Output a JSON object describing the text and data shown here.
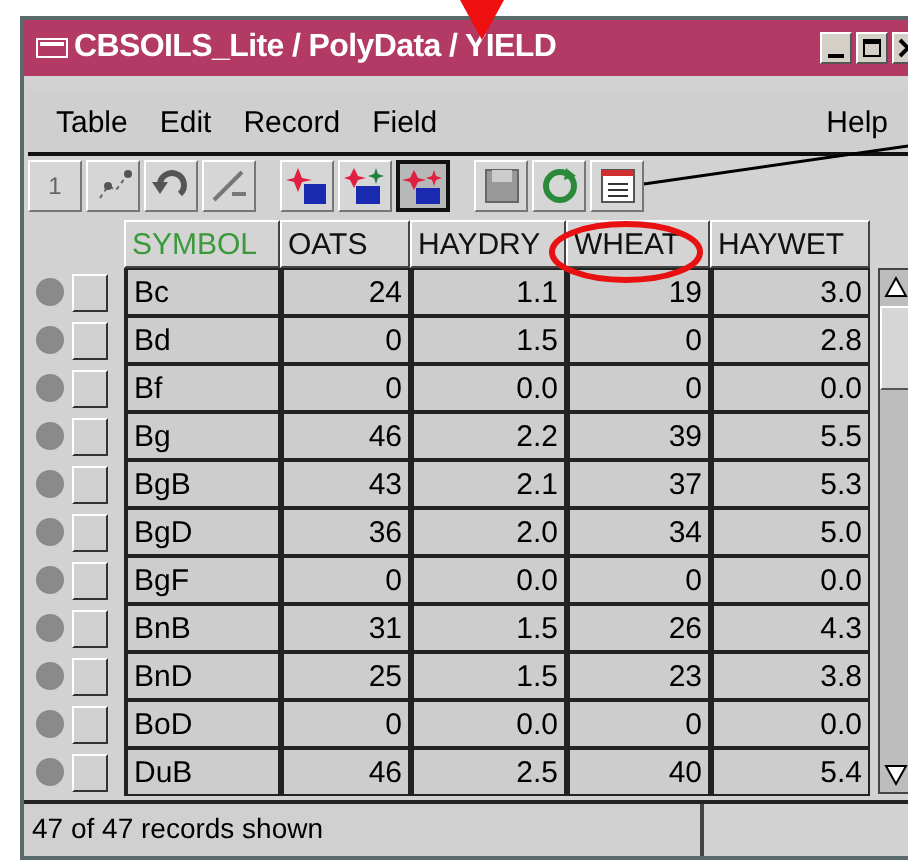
{
  "window": {
    "title": "CBSOILS_Lite / PolyData / YIELD"
  },
  "menu": {
    "items": [
      "Table",
      "Edit",
      "Record",
      "Field"
    ],
    "help": "Help"
  },
  "toolbar": [
    {
      "kind": "number",
      "label": "1",
      "pressed": false
    },
    {
      "kind": "scatter",
      "pressed": false
    },
    {
      "kind": "undo",
      "pressed": false
    },
    {
      "kind": "edit",
      "pressed": false
    },
    {
      "kind": "add",
      "pressed": false
    },
    {
      "kind": "add-multi",
      "pressed": false
    },
    {
      "kind": "select",
      "pressed": true
    },
    {
      "kind": "save",
      "pressed": false
    },
    {
      "kind": "refresh",
      "pressed": false
    },
    {
      "kind": "list",
      "pressed": false
    }
  ],
  "table": {
    "columns": [
      {
        "label": "SYMBOL",
        "selected": true
      },
      {
        "label": "OATS",
        "selected": false
      },
      {
        "label": "HAYDRY",
        "selected": false
      },
      {
        "label": "WHEAT",
        "selected": false
      },
      {
        "label": "HAYWET",
        "selected": false
      }
    ],
    "rows": [
      {
        "checked": false,
        "cells": [
          "Bc",
          "24",
          "1.1",
          "19",
          "3.0"
        ]
      },
      {
        "checked": false,
        "cells": [
          "Bd",
          "0",
          "1.5",
          "0",
          "2.8"
        ]
      },
      {
        "checked": false,
        "cells": [
          "Bf",
          "0",
          "0.0",
          "0",
          "0.0"
        ]
      },
      {
        "checked": false,
        "cells": [
          "Bg",
          "46",
          "2.2",
          "39",
          "5.5"
        ]
      },
      {
        "checked": false,
        "cells": [
          "BgB",
          "43",
          "2.1",
          "37",
          "5.3"
        ]
      },
      {
        "checked": false,
        "cells": [
          "BgD",
          "36",
          "2.0",
          "34",
          "5.0"
        ]
      },
      {
        "checked": false,
        "cells": [
          "BgF",
          "0",
          "0.0",
          "0",
          "0.0"
        ]
      },
      {
        "checked": false,
        "cells": [
          "BnB",
          "31",
          "1.5",
          "26",
          "4.3"
        ]
      },
      {
        "checked": false,
        "cells": [
          "BnD",
          "25",
          "1.5",
          "23",
          "3.8"
        ]
      },
      {
        "checked": false,
        "cells": [
          "BoD",
          "0",
          "0.0",
          "0",
          "0.0"
        ]
      },
      {
        "checked": false,
        "cells": [
          "DuB",
          "46",
          "2.5",
          "40",
          "5.4"
        ]
      }
    ]
  },
  "status_bar": "47 of 47 records shown"
}
